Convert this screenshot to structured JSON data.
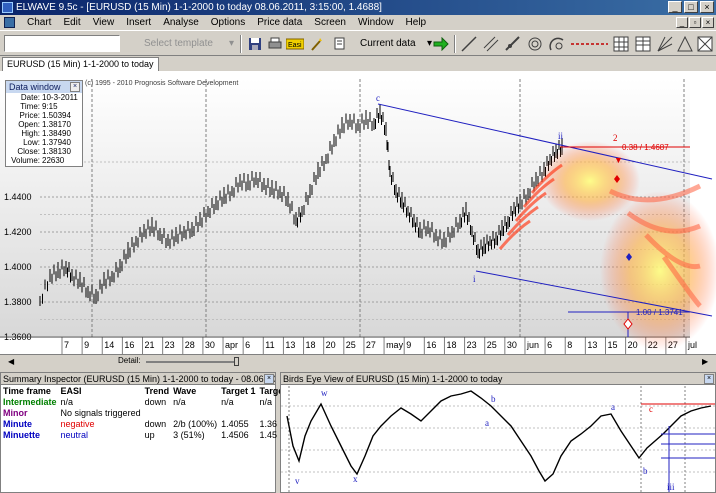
{
  "window": {
    "title": "ELWAVE 9.5c - [EURUSD (15 Min)  1-1-2000 to today  08.06.2011, 3:15:00, 1.4688]",
    "minimize": "_",
    "maximize": "□",
    "close": "×"
  },
  "menu": {
    "items": [
      "Chart",
      "Edit",
      "View",
      "Insert",
      "Analyse",
      "Options",
      "Price data",
      "Screen",
      "Window",
      "Help"
    ]
  },
  "toolbar": {
    "template_placeholder": "Select template",
    "current_data": "Current data"
  },
  "tab": {
    "label": "EURUSD (15 Min)  1-1-2000 to today"
  },
  "chart": {
    "copyright": "(c) 1995 - 2010 Prognosis Software Development",
    "price_axis": [
      "1.4400",
      "1.4200",
      "1.4000",
      "1.3800",
      "1.3600"
    ],
    "date_axis": [
      "7",
      "9",
      "14",
      "16",
      "21",
      "23",
      "28",
      "30",
      "apr",
      "6",
      "11",
      "13",
      "18",
      "20",
      "25",
      "27",
      "may",
      "9",
      "16",
      "18",
      "23",
      "25",
      "30",
      "jun",
      "6",
      "8",
      "13",
      "15",
      "20",
      "22",
      "27",
      "jul"
    ],
    "target_upper": "0.38 / 1.4687",
    "target_lower": "1.00 / 1.3741",
    "wave_labels": [
      "c",
      "i",
      "ii",
      "2"
    ]
  },
  "data_window": {
    "title": "Data window",
    "rows": [
      {
        "k": "Date:",
        "v": "10-3-2011"
      },
      {
        "k": "Time:",
        "v": "9:15"
      },
      {
        "k": "Price:",
        "v": "1.50394"
      },
      {
        "k": "Open:",
        "v": "1.38170"
      },
      {
        "k": "High:",
        "v": "1.38490"
      },
      {
        "k": "Low:",
        "v": "1.37940"
      },
      {
        "k": "Close:",
        "v": "1.38130"
      },
      {
        "k": "Volume:",
        "v": "22630"
      }
    ]
  },
  "detail": {
    "label": "Detail:"
  },
  "summary": {
    "title": "Summary Inspector (EURUSD (15 Min)  1-1-2000 to today - 08.06.2011, 3:15:00, 1.4688)",
    "headers": [
      "Time frame",
      "EASI",
      "Trend",
      "Wave",
      "Target 1",
      "Targe"
    ],
    "rows": [
      {
        "tf": "Intermediate",
        "easi": "n/a",
        "trend": "down",
        "wave": "n/a",
        "t1": "n/a",
        "t2": "n/a",
        "color": "#008000"
      },
      {
        "tf": "Minor",
        "easi": "No signals triggered",
        "trend": "",
        "wave": "",
        "t1": "",
        "t2": "",
        "color": "#800080"
      },
      {
        "tf": "Minute",
        "easi": "negative",
        "trend": "down",
        "wave": "2/b (100%)",
        "t1": "1.4055",
        "t2": "1.36",
        "color": "#0000c0"
      },
      {
        "tf": "Minuette",
        "easi": "neutral",
        "trend": "up",
        "wave": "3 (51%)",
        "t1": "1.4506",
        "t2": "1.45",
        "color": "#0000c0"
      }
    ],
    "easi_colors": {
      "negative": "#e00000",
      "neutral": "#0000c0"
    }
  },
  "birds_eye": {
    "title": "Birds Eye View of EURUSD (15 Min)  1-1-2000 to today",
    "labels": [
      "w",
      "b",
      "a",
      "a",
      "b",
      "x",
      "v",
      "c",
      "iii"
    ]
  },
  "colors": {
    "wave_blue": "#2020c0",
    "target_red": "#e00000"
  }
}
